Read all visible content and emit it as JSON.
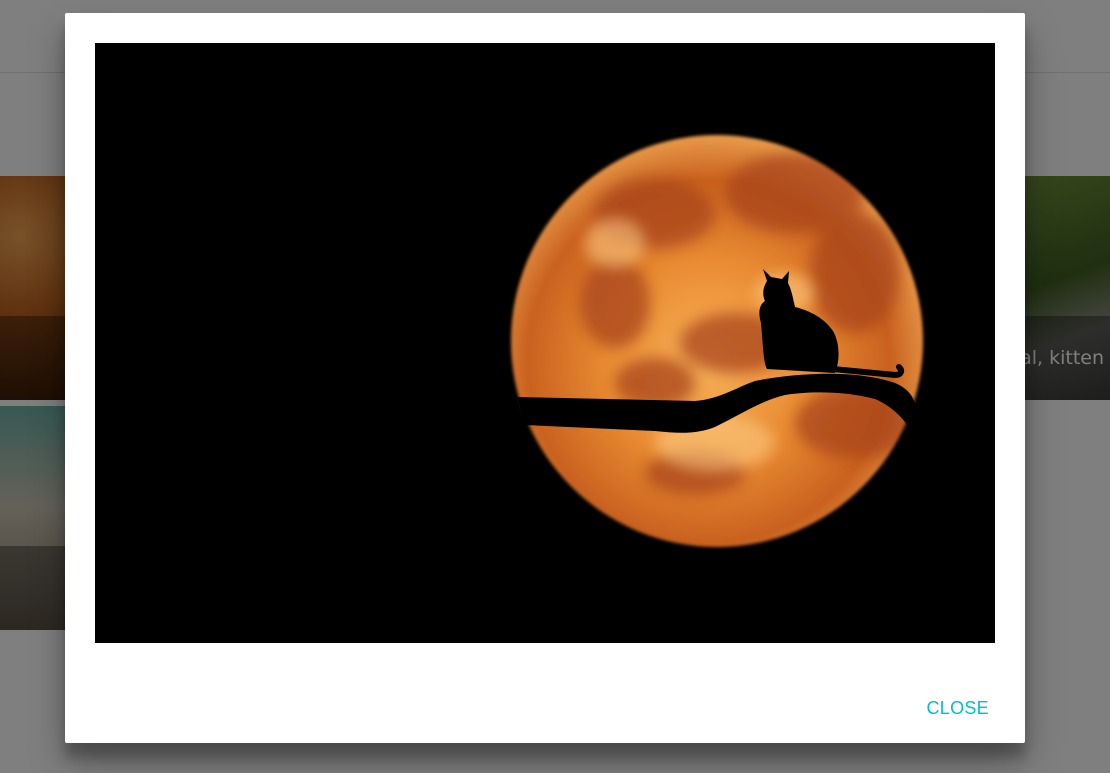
{
  "background": {
    "tiles": [
      {
        "caption": ""
      },
      {
        "caption": "animal, kitten"
      },
      {
        "caption": ""
      }
    ]
  },
  "dialog": {
    "image_subject": "cat silhouette on branch against full moon",
    "close_label": "CLOSE"
  },
  "colors": {
    "accent": "#00bcd4",
    "moon_light": "#f2a34a",
    "moon_dark": "#b9501b"
  }
}
